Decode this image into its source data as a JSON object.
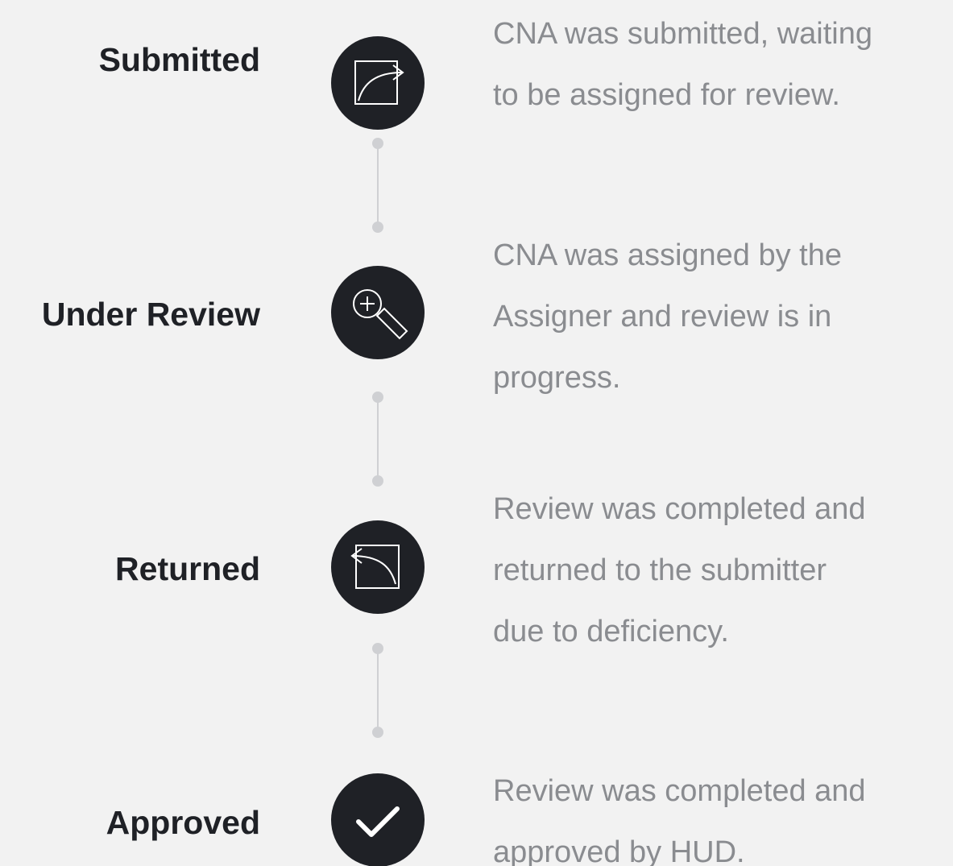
{
  "steps": [
    {
      "label": "Submitted",
      "icon": "export-arrow-icon",
      "description": [
        "CNA was submitted, waiting",
        "to be assigned for review."
      ]
    },
    {
      "label": "Under Review",
      "icon": "zoom-in-magnifier-icon",
      "description": [
        "CNA was assigned by the",
        "Assigner and review is in",
        "progress."
      ]
    },
    {
      "label": "Returned",
      "icon": "return-arrow-icon",
      "description": [
        "Review was completed and",
        "returned to the submitter",
        "due to deficiency."
      ]
    },
    {
      "label": "Approved",
      "icon": "checkmark-icon",
      "description": [
        "Review was completed and",
        "approved by HUD."
      ]
    }
  ],
  "colors": {
    "background": "#f2f2f2",
    "icon_circle": "#1f2126",
    "label_text": "#1f2126",
    "description_text": "#8a8c90",
    "connector": "#cfd0d3"
  }
}
